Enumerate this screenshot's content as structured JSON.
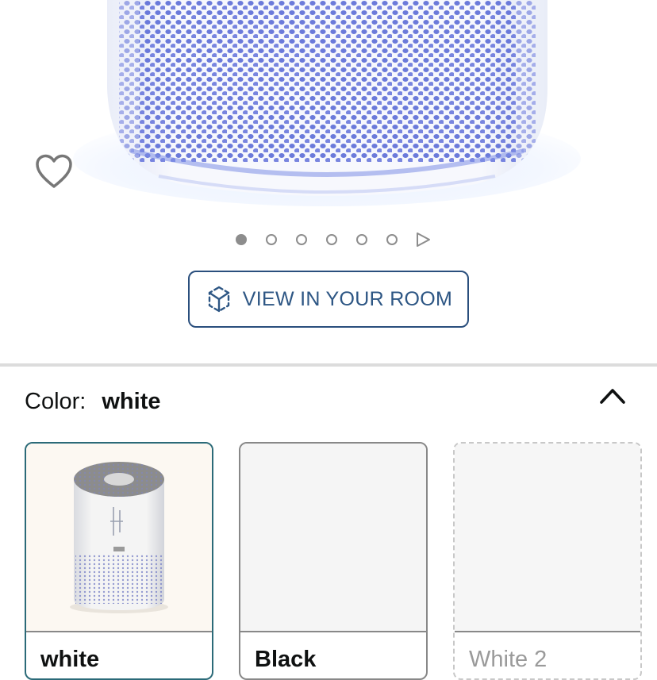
{
  "hero": {
    "wishlist_icon": "heart-outline-icon",
    "image": "air-purifier-closeup"
  },
  "carousel": {
    "dot_count": 6,
    "active_index": 0,
    "next_icon": "play-triangle-icon"
  },
  "view_in_room": {
    "label": "VIEW IN YOUR ROOM",
    "icon": "ar-cube-icon"
  },
  "color": {
    "label": "Color:",
    "selected": "white",
    "collapse_icon": "chevron-up-icon"
  },
  "swatches": [
    {
      "name": "white",
      "selected": true,
      "image": "white-air-purifier"
    },
    {
      "name": "Black",
      "selected": false,
      "image": ""
    },
    {
      "name": "White 2",
      "selected": false,
      "unavailable": true,
      "image": ""
    }
  ],
  "colors": {
    "link": "#2d5684",
    "selected_border": "#2b6a78",
    "dot": "#8d8d8d"
  }
}
